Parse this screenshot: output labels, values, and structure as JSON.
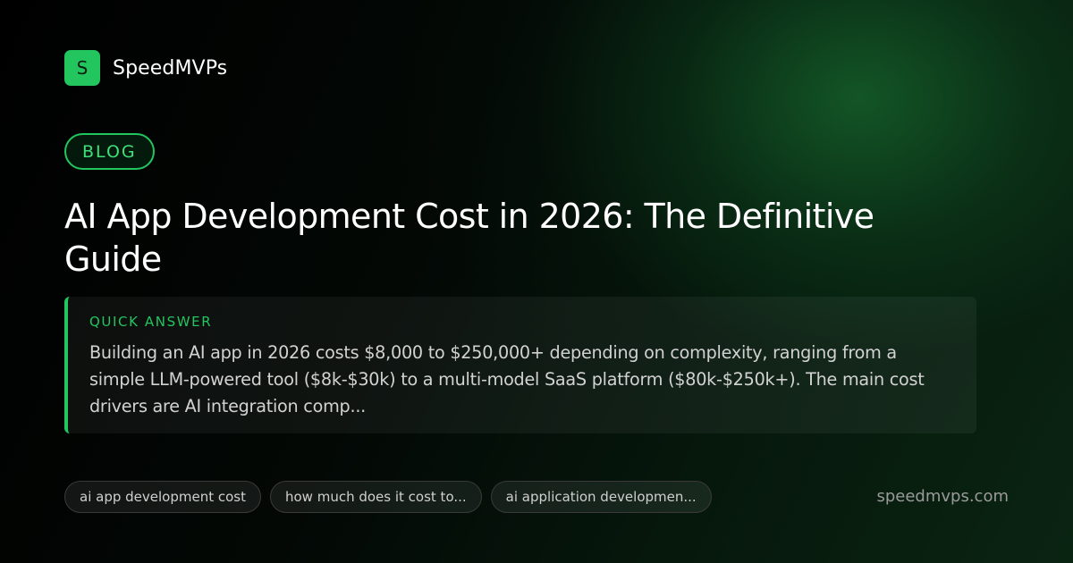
{
  "brand": {
    "logo_letter": "S",
    "name": "SpeedMVPs"
  },
  "category": "BLOG",
  "title": "AI App Development Cost in 2026: The Definitive Guide",
  "quick_answer": {
    "label": "QUICK ANSWER",
    "text": "Building an AI app in 2026 costs $8,000 to $250,000+ depending on complexity, ranging from a simple LLM-powered tool ($8k-$30k) to a multi-model SaaS platform ($80k-$250k+). The main cost drivers are AI integration comp..."
  },
  "tags": [
    "ai app development cost",
    "how much does it cost to...",
    "ai application developmen..."
  ],
  "site_url": "speedmvps.com",
  "colors": {
    "accent": "#22c55e",
    "background": "#000000",
    "glow": "#186e30"
  }
}
